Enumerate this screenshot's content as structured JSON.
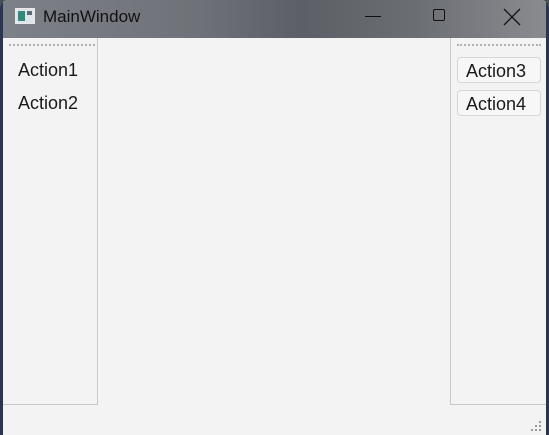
{
  "window": {
    "title": "MainWindow",
    "icon": "app-window-icon"
  },
  "caption_buttons": {
    "minimize_icon": "minimize-icon",
    "maximize_icon": "maximize-icon",
    "close_icon": "close-icon"
  },
  "toolbar_left": {
    "actions": [
      {
        "label": "Action1"
      },
      {
        "label": "Action2"
      }
    ]
  },
  "toolbar_right": {
    "actions": [
      {
        "label": "Action3"
      },
      {
        "label": "Action4"
      }
    ]
  },
  "colors": {
    "window_bg": "#f3f3f3",
    "titlebar": "#6f7278",
    "frame": "#2a3550"
  }
}
